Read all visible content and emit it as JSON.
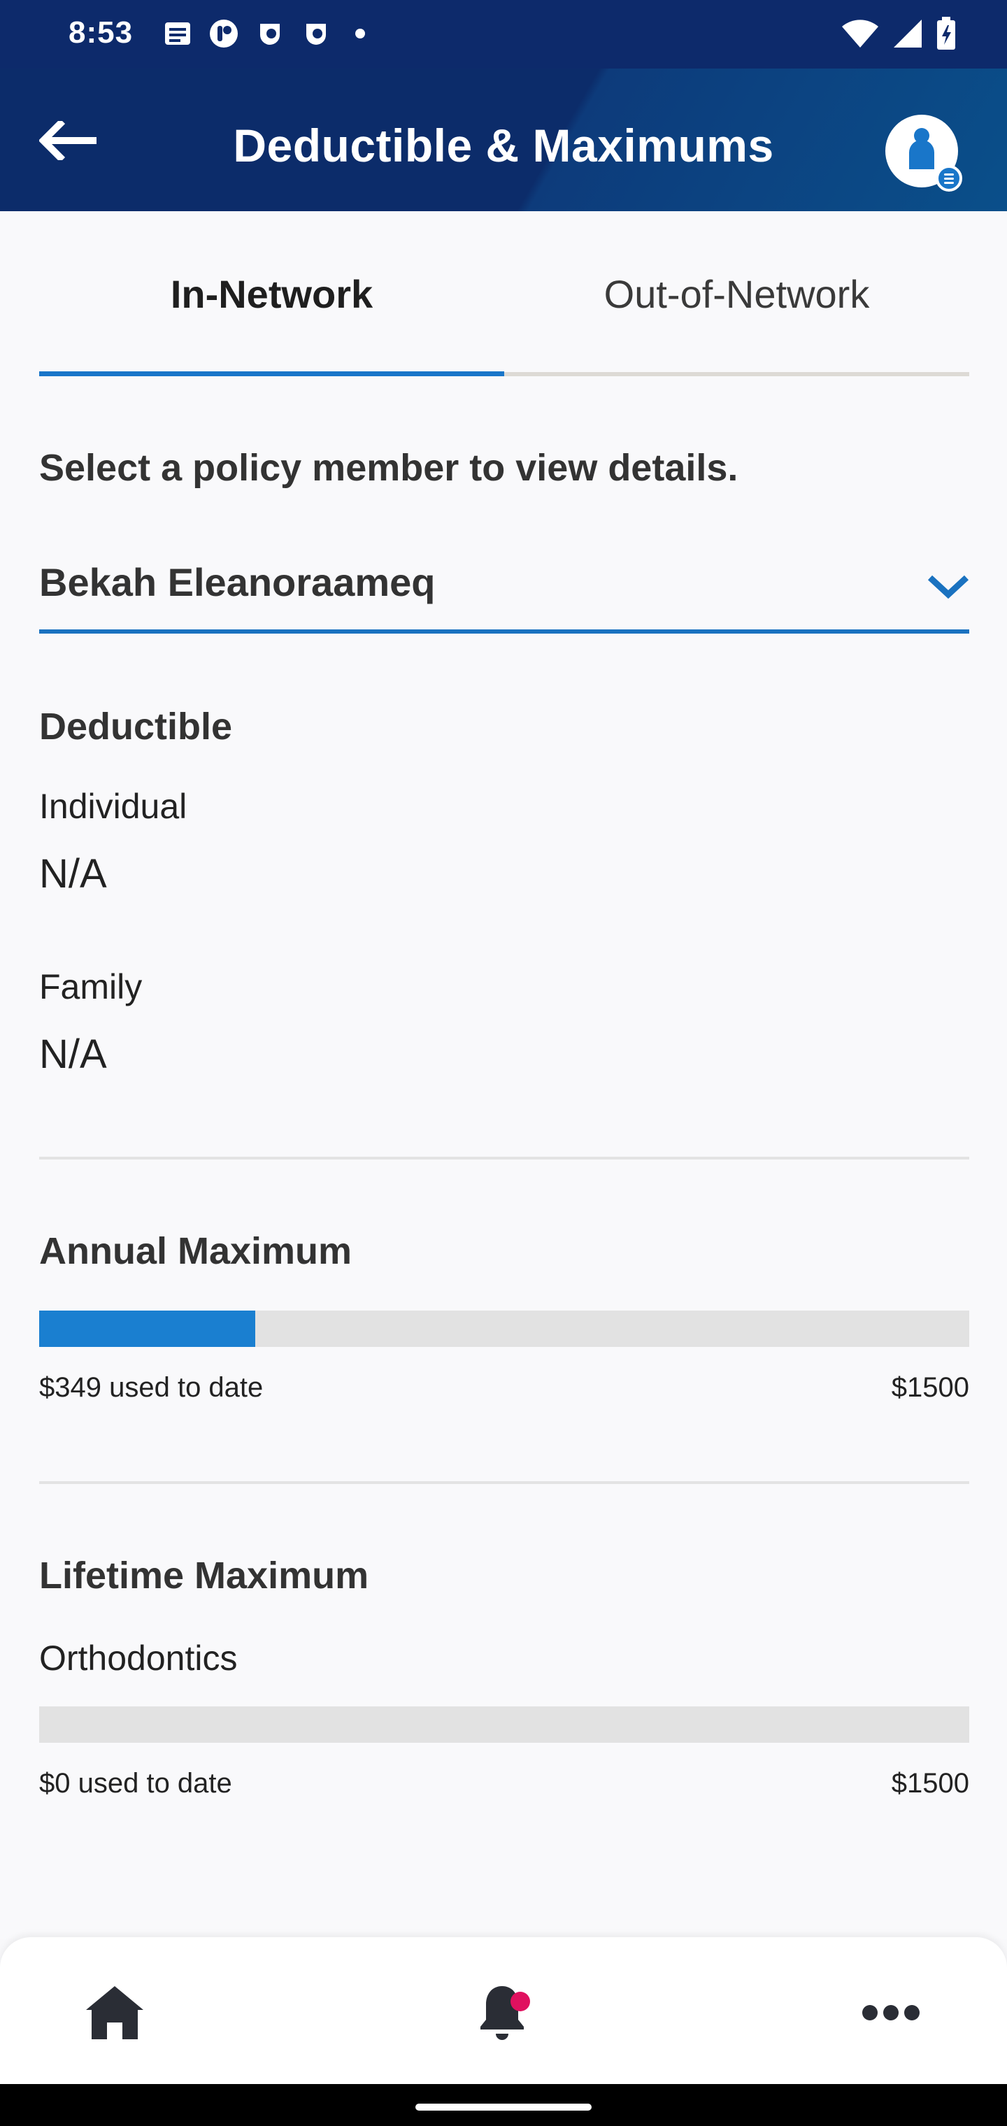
{
  "status_bar": {
    "time": "8:53",
    "left_icons": [
      "calendar-icon",
      "app-icon",
      "app-icon",
      "app-icon"
    ],
    "right_icons": [
      "wifi-icon",
      "signal-icon",
      "battery-icon"
    ]
  },
  "header": {
    "title": "Deductible & Maximums",
    "back_icon": "arrow-left-icon",
    "profile_icon": "person-icon"
  },
  "tabs": [
    {
      "label": "In-Network",
      "active": true
    },
    {
      "label": "Out-of-Network",
      "active": false
    }
  ],
  "prompt": "Select a policy member to view details.",
  "member_select": {
    "value": "Bekah Eleanoraameq",
    "icon": "chevron-down-icon"
  },
  "deductible": {
    "title": "Deductible",
    "individual_label": "Individual",
    "individual_value": "N/A",
    "family_label": "Family",
    "family_value": "N/A"
  },
  "annual_maximum": {
    "title": "Annual Maximum",
    "used_text": "$349 used to date",
    "max_text": "$1500",
    "used": 349,
    "max": 1500
  },
  "lifetime_maximum": {
    "title": "Lifetime Maximum",
    "category": "Orthodontics",
    "used_text": "$0 used to date",
    "max_text": "$1500",
    "used": 0,
    "max": 1500
  },
  "bottom_nav": {
    "items": [
      "home-icon",
      "bell-icon",
      "more-icon"
    ],
    "notification_dot": true
  },
  "colors": {
    "header_bg": "#0c2c6a",
    "accent": "#1976c9",
    "progress_fill": "#1a7fd0",
    "notification_dot": "#e0115f"
  }
}
